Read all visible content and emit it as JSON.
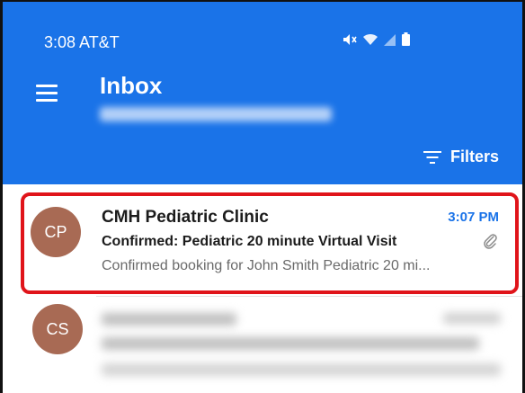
{
  "status_bar": {
    "time_carrier": "3:08 AT&T",
    "icons": [
      "mute-icon",
      "wifi-icon",
      "signal-icon",
      "battery-icon"
    ]
  },
  "header": {
    "title": "Inbox",
    "filters_label": "Filters"
  },
  "messages": [
    {
      "avatar_initials": "CP",
      "sender": "CMH Pediatric Clinic",
      "time": "3:07 PM",
      "subject": "Confirmed: Pediatric 20 minute Virtual Visit",
      "preview": "Confirmed booking for John Smith Pediatric 20 mi...",
      "has_attachment": true,
      "highlighted": true
    },
    {
      "avatar_initials": "CS",
      "blurred": true
    }
  ],
  "colors": {
    "app_bar": "#1a73e8",
    "avatar": "#a86a54",
    "highlight_border": "#e0141a",
    "time_accent": "#1a73e8"
  }
}
